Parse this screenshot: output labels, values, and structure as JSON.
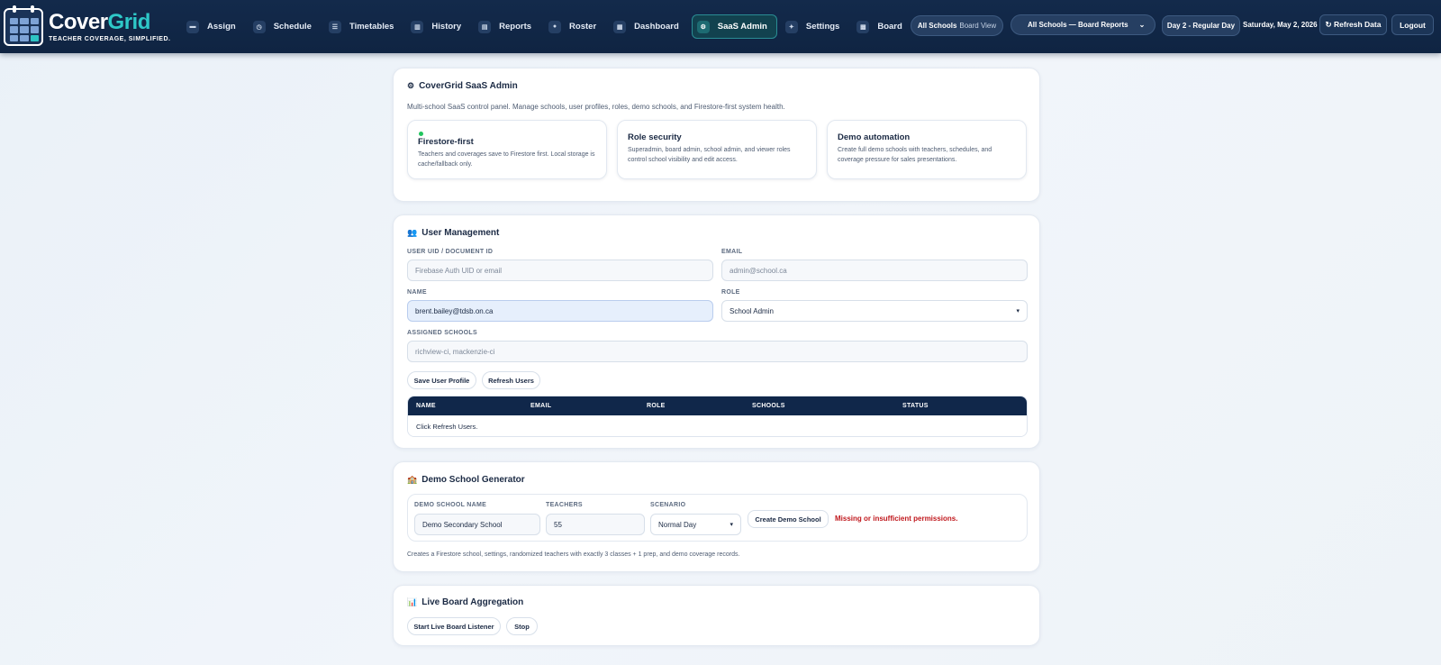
{
  "brand": {
    "name_part1": "Cover",
    "name_part2": "Grid",
    "tagline": "TEACHER COVERAGE, SIMPLIFIED."
  },
  "nav": [
    {
      "label": "Assign",
      "icon": "clipboard-icon",
      "glyph": "▬"
    },
    {
      "label": "Schedule",
      "icon": "clock-icon",
      "glyph": "◷"
    },
    {
      "label": "Timetables",
      "icon": "table-icon",
      "glyph": "☰"
    },
    {
      "label": "History",
      "icon": "history-icon",
      "glyph": "▥"
    },
    {
      "label": "Reports",
      "icon": "report-icon",
      "glyph": "▤"
    },
    {
      "label": "Roster",
      "icon": "roster-icon",
      "glyph": "●"
    },
    {
      "label": "Dashboard",
      "icon": "dashboard-icon",
      "glyph": "▦"
    },
    {
      "label": "SaaS Admin",
      "icon": "gear-icon",
      "glyph": "⚙"
    },
    {
      "label": "Settings",
      "icon": "sparkle-icon",
      "glyph": "✦"
    },
    {
      "label": "Board",
      "icon": "board-icon",
      "glyph": "▩"
    }
  ],
  "header": {
    "view_main": "All Schools",
    "view_sub": "Board View",
    "school_select": "All Schools — Board Reports",
    "day_type": "Day 2 - Regular Day",
    "date": "Saturday, May 2, 2026",
    "refresh": "↻ Refresh Data",
    "logout": "Logout"
  },
  "admin": {
    "icon": "gear-icon",
    "title": "CoverGrid SaaS Admin",
    "description": "Multi-school SaaS control panel. Manage schools, user profiles, roles, demo schools, and Firestore-first system health.",
    "features": [
      {
        "title": "Firestore-first",
        "text": "Teachers and coverages save to Firestore first. Local storage is cache/fallback only."
      },
      {
        "title": "Role security",
        "text": "Superadmin, board admin, school admin, and viewer roles control school visibility and edit access."
      },
      {
        "title": "Demo automation",
        "text": "Create full demo schools with teachers, schedules, and coverage pressure for sales presentations."
      }
    ]
  },
  "users": {
    "icon": "users-icon",
    "title": "User Management",
    "uid_label": "USER UID / DOCUMENT ID",
    "uid_placeholder": "Firebase Auth UID or email",
    "email_label": "EMAIL",
    "email_placeholder": "admin@school.ca",
    "name_label": "NAME",
    "name_value": "brent.bailey@tdsb.on.ca",
    "role_label": "ROLE",
    "role_value": "School Admin",
    "schools_label": "ASSIGNED SCHOOLS",
    "schools_placeholder": "richview-ci, mackenzie-ci",
    "save_button": "Save User Profile",
    "refresh_button": "Refresh Users",
    "table_headers": [
      "NAME",
      "EMAIL",
      "ROLE",
      "SCHOOLS",
      "STATUS"
    ],
    "table_empty": "Click Refresh Users."
  },
  "demo": {
    "icon": "school-icon",
    "title": "Demo School Generator",
    "name_label": "DEMO SCHOOL NAME",
    "name_value": "Demo Secondary School",
    "teachers_label": "TEACHERS",
    "teachers_value": "55",
    "scenario_label": "SCENARIO",
    "scenario_value": "Normal Day",
    "create_button": "Create Demo School",
    "error": "Missing or insufficient permissions.",
    "note": "Creates a Firestore school, settings, randomized teachers with exactly 3 classes + 1 prep, and demo coverage records."
  },
  "live": {
    "icon": "chart-icon",
    "title": "Live Board Aggregation",
    "start_button": "Start Live Board Listener",
    "stop_button": "Stop"
  },
  "colors": {
    "navy": "#132a4b",
    "teal": "#2ec8c8",
    "error": "#c0181d",
    "success": "#22c55e"
  }
}
